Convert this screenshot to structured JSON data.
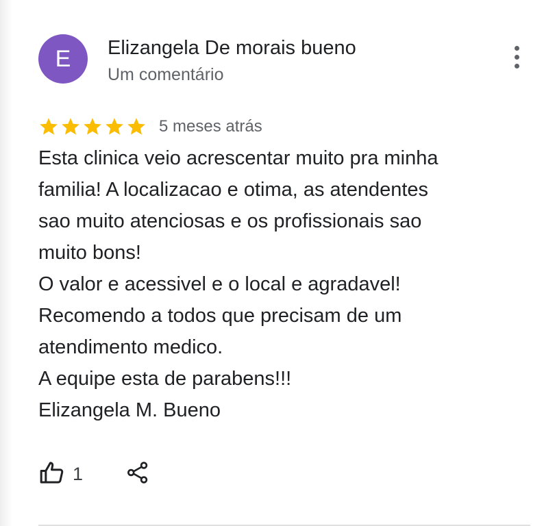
{
  "review": {
    "author": {
      "initial": "E",
      "name": "Elizangela De morais bueno",
      "subtitle": "Um comentário",
      "avatar_color": "#7e57c2"
    },
    "rating": 5,
    "max_rating": 5,
    "star_color": "#fbbc04",
    "time_ago": "5 meses atrás",
    "text_lines": [
      "Esta clinica veio acrescentar muito pra minha",
      "familia! A localizacao e otima, as atendentes",
      "sao muito atenciosas e os profissionais sao",
      "muito bons!",
      "O valor e acessivel e o local e agradavel!",
      "Recomendo a todos que precisam de um",
      "atendimento medico.",
      "A equipe esta de parabens!!!",
      "Elizangela M. Bueno"
    ],
    "actions": {
      "like_icon": "thumbs-up-icon",
      "like_count": "1",
      "share_icon": "share-icon",
      "more_icon": "more-vert-icon"
    }
  }
}
